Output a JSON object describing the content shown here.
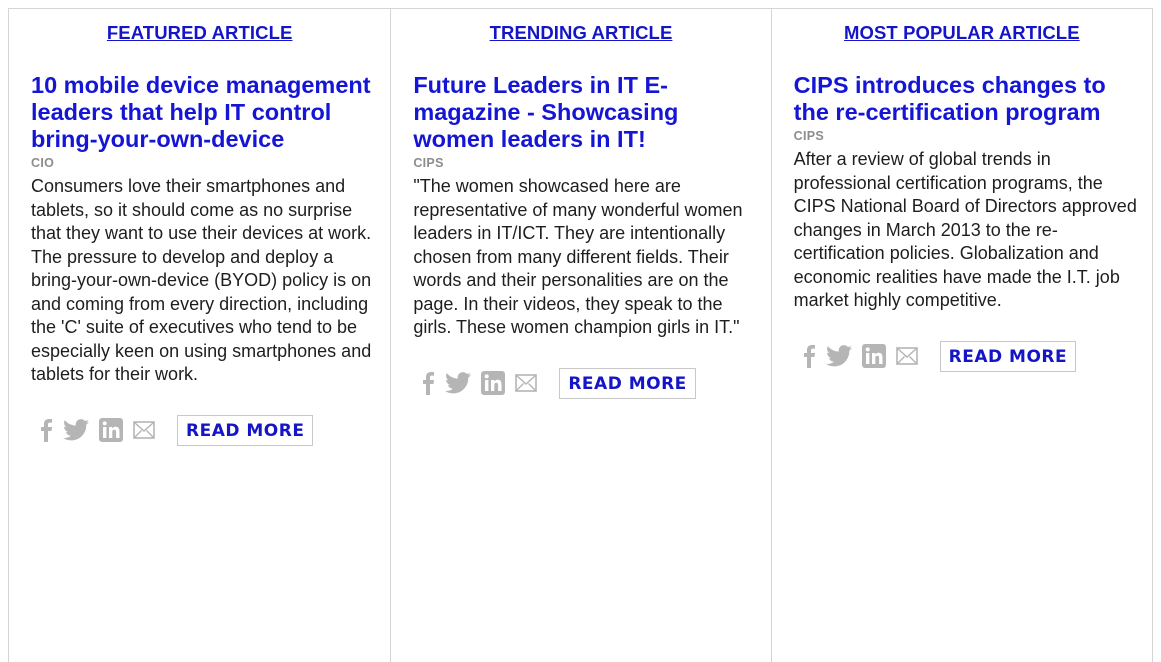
{
  "columns": [
    {
      "header": "FEATURED ARTICLE",
      "title": "10 mobile device management leaders that help IT control bring-your-own-device",
      "source": "CIO",
      "body": "Consumers love their smartphones and tablets, so it should come as no surprise that they want to use their devices at work. The pressure to develop and deploy a bring-your-own-device (BYOD) policy is on and coming from every direction, including the 'C' suite of executives who tend to be especially keen on using smartphones and tablets for their work.",
      "read_more": "READ MORE"
    },
    {
      "header": "TRENDING ARTICLE",
      "title": "Future Leaders in IT E-magazine - Showcasing women leaders in IT!",
      "source": "CIPS",
      "body": "\"The women showcased here are representative of many wonderful women leaders in IT/ICT. They are intentionally chosen from many different fields. Their words and their personalities are on the page. In their videos, they speak to the girls. These women champion girls in IT.\"",
      "read_more": "READ MORE"
    },
    {
      "header": "MOST POPULAR ARTICLE",
      "title": "CIPS introduces changes to the re-certification program",
      "source": "CIPS",
      "body": "After a review of global trends in professional certification programs, the CIPS National Board of Directors approved changes in March 2013 to the re-certification policies. Globalization and economic realities have made the I.T. job market highly competitive.",
      "read_more": "READ MORE"
    }
  ],
  "share_icons": [
    "facebook-icon",
    "twitter-icon",
    "linkedin-icon",
    "email-icon"
  ],
  "colors": {
    "link": "#1515c8",
    "title": "#1515d6",
    "source": "#8c8c8c",
    "icon": "#b5b5b5",
    "border": "#d4d4d4"
  }
}
